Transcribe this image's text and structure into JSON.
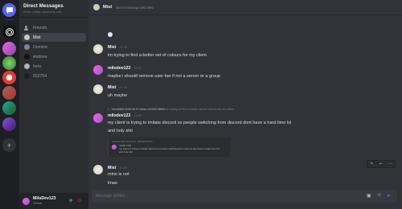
{
  "sidebar": {
    "title": "Direct Messages",
    "subtitle": "http://dms.discord.com",
    "items": [
      {
        "label": "Friends"
      },
      {
        "label": "Mist"
      },
      {
        "label": "Dominic"
      },
      {
        "label": "Andrew"
      },
      {
        "label": "here"
      },
      {
        "label": "552754"
      }
    ]
  },
  "user_panel": {
    "name": "MiloDev123",
    "status": "Online"
  },
  "header": {
    "name": "Mist",
    "description": "Direct message with Mist"
  },
  "messages": [
    {
      "author": "Mist",
      "time": "21:25",
      "lines": [
        "im trying to find a better set of colours for my client"
      ]
    },
    {
      "author": "milodev123",
      "time": "21:25",
      "lines": [
        "maybe i should remove user bar if not a server or a group"
      ]
    },
    {
      "author": "Mist",
      "time": "21:26",
      "lines": [
        "uh maybe"
      ]
    },
    {
      "author": "milodev123",
      "time": "21:26",
      "lines": [
        "my client is trying to imitate discord so people switching from discord dont have a hard time lol",
        "and holy shit"
      ]
    },
    {
      "author": "Mist",
      "time": "21:28",
      "lines": [
        "mine is not",
        "lmao"
      ]
    }
  ],
  "reply": {
    "id": "7ebdf463-5b9f-4b70-9edc-e1f28378899",
    "text": "im trying to find a better set of colours for my client"
  },
  "embed": {
    "top": "repeater.kitit.net/s/Ims/_u6RNFP84O5",
    "author": "milodev123",
    "text": "my client is trying to imitate discord so people switching from discord dont have a hard time lol",
    "text2": "and holy shit"
  },
  "composer": {
    "placeholder": "Message @Mist..."
  },
  "colors": {
    "accent": "#5865f2",
    "online": "#23a55a",
    "bg": "#313338",
    "sidebar": "#2b2d31",
    "rail": "#1e1f22"
  }
}
